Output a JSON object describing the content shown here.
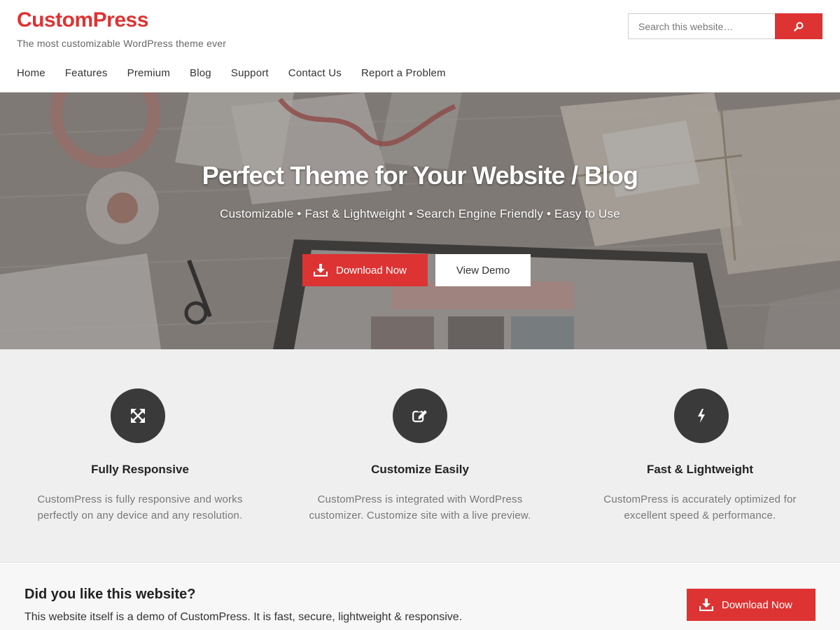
{
  "header": {
    "logo": "CustomPress",
    "tagline": "The most customizable WordPress theme ever",
    "search_placeholder": "Search this website…",
    "search_icon": "search-icon"
  },
  "nav": {
    "items": [
      "Home",
      "Features",
      "Premium",
      "Blog",
      "Support",
      "Contact Us",
      "Report a Problem"
    ]
  },
  "hero": {
    "title": "Perfect Theme for Your Website / Blog",
    "subtitle": "Customizable • Fast & Lightweight • Search Engine Friendly • Easy to Use",
    "download_label": "Download Now",
    "download_icon": "download-icon",
    "demo_label": "View Demo"
  },
  "features": [
    {
      "icon": "expand-icon",
      "title": "Fully Responsive",
      "text": "CustomPress is fully responsive and works perfectly on any device and any resolution."
    },
    {
      "icon": "edit-icon",
      "title": "Customize Easily",
      "text": "CustomPress is integrated with WordPress customizer. Customize site with a live preview."
    },
    {
      "icon": "bolt-icon",
      "title": "Fast & Lightweight",
      "text": "CustomPress is accurately optimized for excellent speed & performance."
    }
  ],
  "cta": {
    "title": "Did you like this website?",
    "text": "This website itself is a demo of CustomPress. It is fast, secure, lightweight & responsive.",
    "button_label": "Download Now"
  },
  "colors": {
    "accent": "#dd3333",
    "feature_bg": "#efefef",
    "icon_circle": "#3a3a3a"
  }
}
